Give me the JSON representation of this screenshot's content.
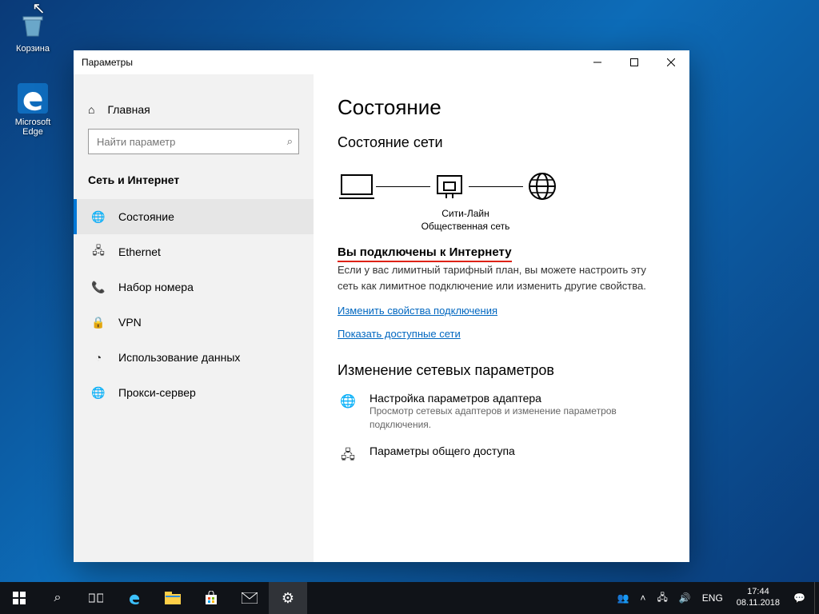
{
  "desktop": {
    "recycle": "Корзина",
    "edge": "Microsoft Edge"
  },
  "window": {
    "title": "Параметры"
  },
  "sidebar": {
    "home": "Главная",
    "search_placeholder": "Найти параметр",
    "group": "Сеть и Интернет",
    "items": [
      {
        "label": "Состояние"
      },
      {
        "label": "Ethernet"
      },
      {
        "label": "Набор номера"
      },
      {
        "label": "VPN"
      },
      {
        "label": "Использование данных"
      },
      {
        "label": "Прокси-сервер"
      }
    ]
  },
  "main": {
    "h1": "Состояние",
    "h2": "Состояние сети",
    "diagram": {
      "net_name": "Сити-Лайн",
      "net_type": "Общественная сеть"
    },
    "connected": "Вы подключены к Интернету",
    "para": "Если у вас лимитный тарифный план, вы можете настроить эту сеть как лимитное подключение или изменить другие свойства.",
    "link1": "Изменить свойства подключения",
    "link2": "Показать доступные сети",
    "h2b": "Изменение сетевых параметров",
    "adv1_t": "Настройка параметров адаптера",
    "adv1_d": "Просмотр сетевых адаптеров и изменение параметров подключения.",
    "adv2_t": "Параметры общего доступа"
  },
  "tray": {
    "lang": "ENG",
    "time": "17:44",
    "date": "08.11.2018"
  }
}
